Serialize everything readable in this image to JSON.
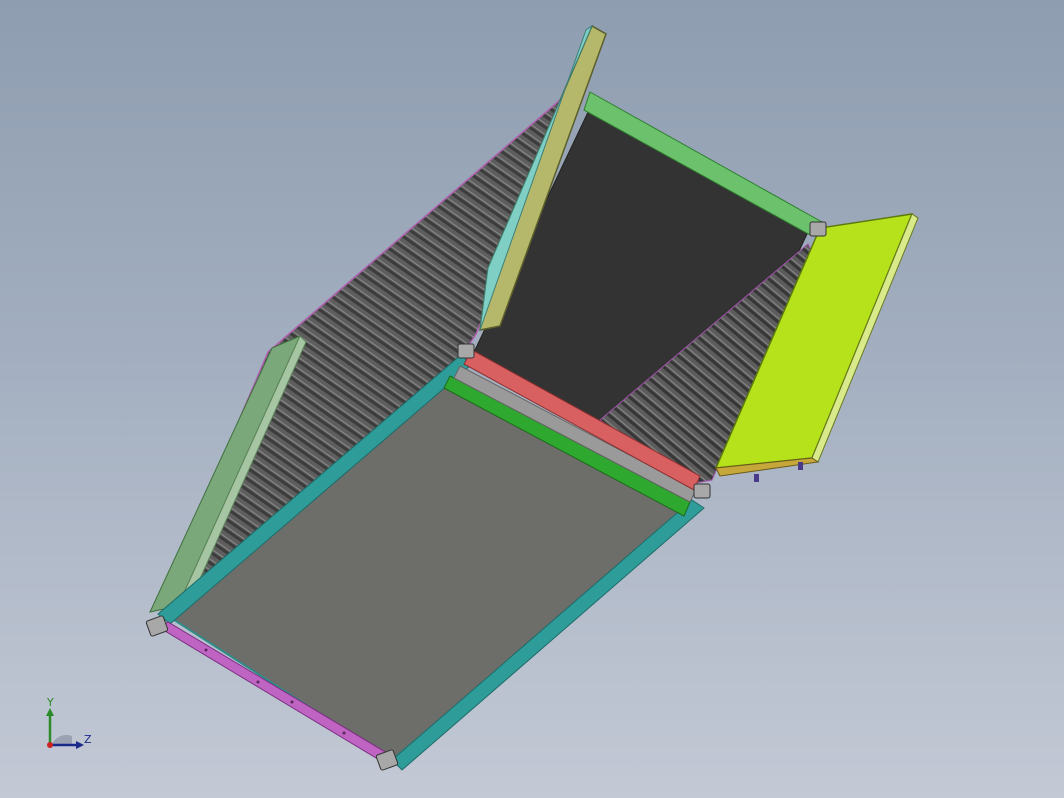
{
  "viewport": {
    "background_top": "#8e9db0",
    "background_bottom": "#c3c9d5"
  },
  "model": {
    "colors": {
      "floor": "#6d6d69",
      "back_wall": "#333333",
      "corrugated_wall": "#5a5a5a",
      "door_right": "#b5e21a",
      "door_left": "#b5b86a",
      "rail_magenta": "#c064c4",
      "rail_teal": "#2e9c98",
      "rail_green": "#5cb85c",
      "rail_red": "#d96060",
      "corner_fitting": "#a8a8a8"
    }
  },
  "triad": {
    "y_label": "Y",
    "z_label": "Z",
    "y_color": "#2a8a2a",
    "z_color": "#1a2a8a",
    "origin_color": "#cc2222"
  }
}
